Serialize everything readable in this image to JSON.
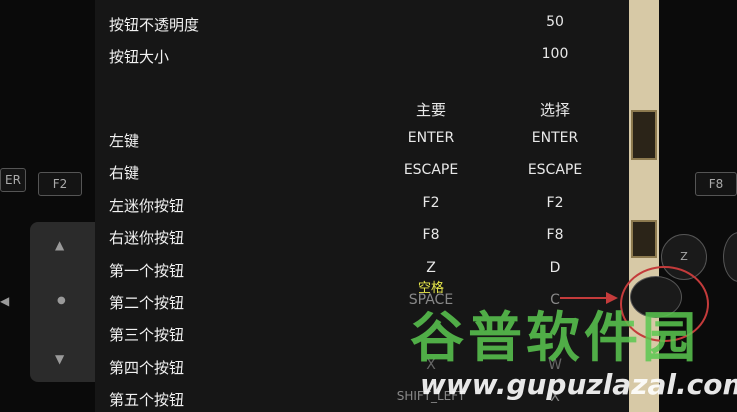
{
  "settings": {
    "opacity": {
      "label": "按钮不透明度",
      "value": "50"
    },
    "size": {
      "label": "按钮大小",
      "value": "100"
    },
    "headers": {
      "main": "主要",
      "alt": "选择"
    },
    "rows": [
      {
        "label": "左键",
        "main": "ENTER",
        "alt": "ENTER"
      },
      {
        "label": "右键",
        "main": "ESCAPE",
        "alt": "ESCAPE"
      },
      {
        "label": "左迷你按钮",
        "main": "F2",
        "alt": "F2"
      },
      {
        "label": "右迷你按钮",
        "main": "F8",
        "alt": "F8"
      },
      {
        "label": "第一个按钮",
        "main": "Z",
        "alt": "D"
      },
      {
        "label": "第二个按钮",
        "main": "SPACE",
        "alt": "C"
      },
      {
        "label": "第三个按钮",
        "main": "",
        "alt": ""
      },
      {
        "label": "第四个按钮",
        "main": "X",
        "alt": "W"
      },
      {
        "label": "第五个按钮",
        "main": "SHIFT_LEFT",
        "alt": "X"
      }
    ],
    "annotation": "空格"
  },
  "overlay_buttons": {
    "left_key": "ER",
    "f2": "F2",
    "f8": "F8",
    "z": "Z"
  },
  "watermark": {
    "text": "谷普软件园",
    "url": "www.gupuzlazal.com"
  },
  "colors": {
    "panel": "#161616",
    "annotation": "#e8e84a",
    "highlight": "#c43b3b",
    "watermark": "#5ac850"
  }
}
